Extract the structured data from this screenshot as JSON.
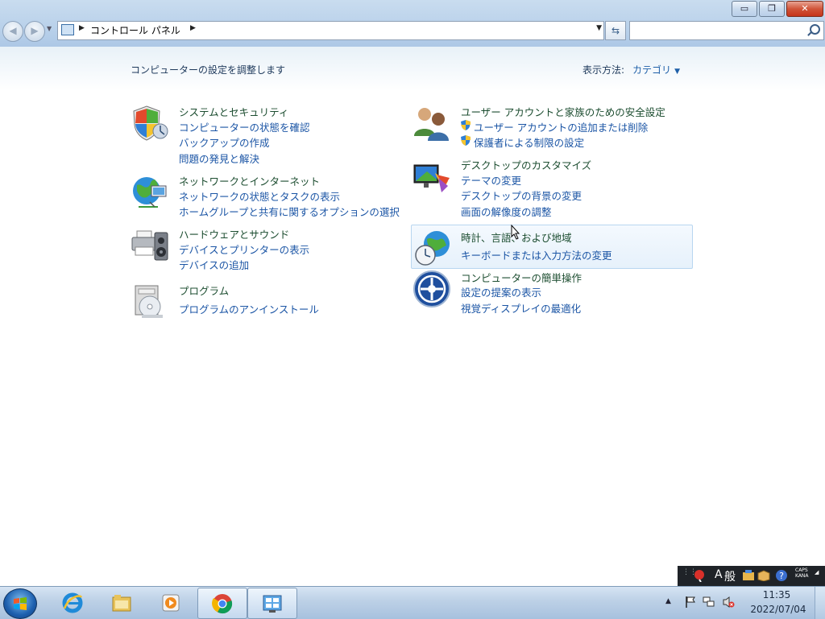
{
  "window": {
    "caption_minimize": "▭",
    "caption_maximize": "❐",
    "caption_close": "✕"
  },
  "address": {
    "breadcrumb": "コントロール パネル",
    "search_placeholder": ""
  },
  "content": {
    "page_title": "コンピューターの設定を調整します",
    "view_by_label": "表示方法:",
    "view_by_value": "カテゴリ"
  },
  "categories_left": [
    {
      "title": "システムとセキュリティ",
      "icon": "shield-icon",
      "links": [
        "コンピューターの状態を確認",
        "バックアップの作成",
        "問題の発見と解決"
      ]
    },
    {
      "title": "ネットワークとインターネット",
      "icon": "network-globe-icon",
      "links": [
        "ネットワークの状態とタスクの表示",
        "ホームグループと共有に関するオプションの選択"
      ]
    },
    {
      "title": "ハードウェアとサウンド",
      "icon": "printer-speaker-icon",
      "links": [
        "デバイスとプリンターの表示",
        "デバイスの追加"
      ]
    },
    {
      "title": "プログラム",
      "icon": "programs-disc-icon",
      "links": [
        "プログラムのアンインストール"
      ]
    }
  ],
  "categories_right": [
    {
      "title": "ユーザー アカウントと家族のための安全設定",
      "icon": "users-icon",
      "links": [
        "ユーザー アカウントの追加または削除",
        "保護者による制限の設定"
      ]
    },
    {
      "title": "デスクトップのカスタマイズ",
      "icon": "desktop-paint-icon",
      "links": [
        "テーマの変更",
        "デスクトップの背景の変更",
        "画面の解像度の調整"
      ]
    },
    {
      "title": "時計、言語、および地域",
      "icon": "clock-globe-icon",
      "links": [
        "キーボードまたは入力方法の変更"
      ]
    },
    {
      "title": "コンピューターの簡単操作",
      "icon": "ease-of-access-icon",
      "links": [
        "設定の提案の表示",
        "視覚ディスプレイの最適化"
      ]
    }
  ],
  "ime": {
    "mode_char": "A",
    "mode_kanji": "般",
    "caps": "CAPS",
    "kana": "KANA"
  },
  "taskbar": {
    "apps": [
      "internet-explorer-icon",
      "file-explorer-icon",
      "media-player-icon",
      "chrome-icon",
      "control-panel-icon"
    ],
    "active_app": "control-panel-icon"
  },
  "tray": {
    "time": "11:35",
    "date": "2022/07/04"
  }
}
